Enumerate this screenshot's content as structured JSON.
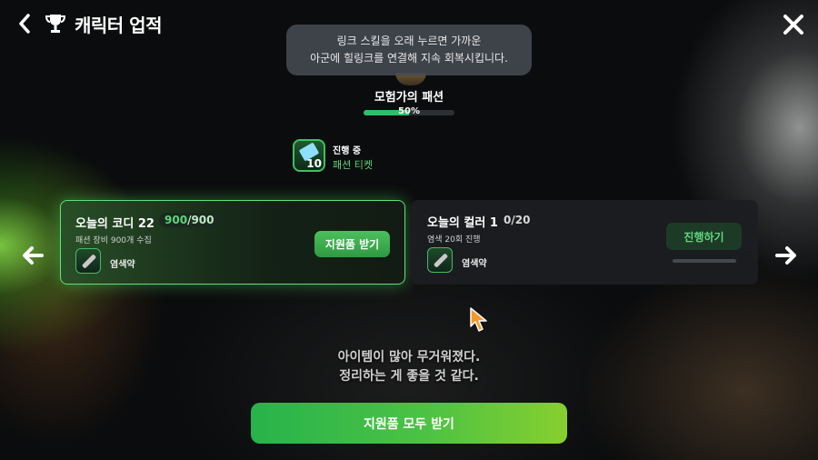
{
  "header": {
    "title": "캐릭터 업적"
  },
  "tooltip": {
    "line1": "링크 스킬을 오래 누르면 가까운",
    "line2": "아군에 힐링크를 연결해 지속 회복시킵니다."
  },
  "season": {
    "title": "모험가의 패션",
    "progress_label": "50%",
    "progress_fraction": 0.5
  },
  "ticket": {
    "status": "진행 중",
    "count": "10",
    "name": "패션 티켓"
  },
  "quests": [
    {
      "title": "오늘의 코디 22",
      "current": "900",
      "total": "/900",
      "description": "패션 장비 900개 수집",
      "reward": "염색약",
      "button_label": "지원품 받기"
    },
    {
      "title": "오늘의 컬러 1",
      "progress": "0/20",
      "description": "염색 20회 진행",
      "reward": "염색약",
      "button_label": "진행하기"
    }
  ],
  "notice": {
    "line1": "아이템이 많아 무거워졌다.",
    "line2": "정리하는 게 좋을 것 같다."
  },
  "footer": {
    "claim_all_label": "지원품 모두 받기"
  },
  "colors": {
    "accent_green": "#2fbf6a",
    "claim_button": "#4cc05c",
    "progress_text": "#5fd67e"
  },
  "icons": [
    "back-arrow-icon",
    "trophy-icon",
    "close-icon",
    "ticket-icon",
    "dye-vial-icon",
    "arrow-left-icon",
    "arrow-right-icon",
    "cursor-icon"
  ]
}
